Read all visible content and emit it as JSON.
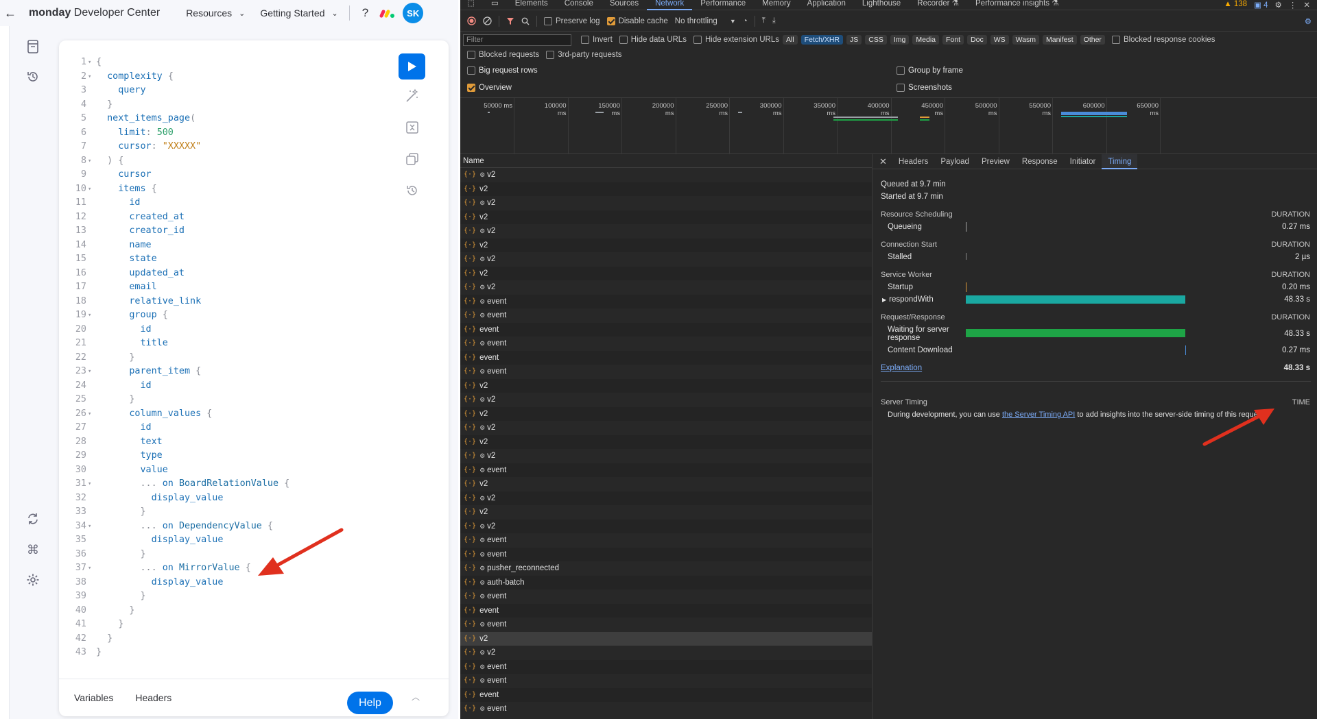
{
  "monday": {
    "brand_bold": "monday",
    "brand_rest": " Developer Center",
    "nav": [
      "Resources",
      "Getting Started"
    ],
    "help_symbol": "?",
    "avatar": "SK",
    "code_lines": [
      {
        "num": "1",
        "fold": true,
        "html": "<span class='p'>{</span>"
      },
      {
        "num": "2",
        "fold": true,
        "html": "  complexity <span class='p'>{</span>"
      },
      {
        "num": "3",
        "fold": false,
        "html": "    query"
      },
      {
        "num": "4",
        "fold": false,
        "html": "  <span class='p'>}</span>"
      },
      {
        "num": "5",
        "fold": false,
        "html": "  next_items_page<span class='p'>(</span>"
      },
      {
        "num": "6",
        "fold": false,
        "html": "    limit<span class='p'>:</span> <span class='n'>500</span>"
      },
      {
        "num": "7",
        "fold": false,
        "html": "    cursor<span class='p'>:</span> <span class='s'>\"XXXXX\"</span>"
      },
      {
        "num": "8",
        "fold": true,
        "html": "  <span class='p'>) {</span>"
      },
      {
        "num": "9",
        "fold": false,
        "html": "    cursor"
      },
      {
        "num": "10",
        "fold": true,
        "html": "    items <span class='p'>{</span>"
      },
      {
        "num": "11",
        "fold": false,
        "html": "      id"
      },
      {
        "num": "12",
        "fold": false,
        "html": "      created_at"
      },
      {
        "num": "13",
        "fold": false,
        "html": "      creator_id"
      },
      {
        "num": "14",
        "fold": false,
        "html": "      name"
      },
      {
        "num": "15",
        "fold": false,
        "html": "      state"
      },
      {
        "num": "16",
        "fold": false,
        "html": "      updated_at"
      },
      {
        "num": "17",
        "fold": false,
        "html": "      email"
      },
      {
        "num": "18",
        "fold": false,
        "html": "      relative_link"
      },
      {
        "num": "19",
        "fold": true,
        "html": "      group <span class='p'>{</span>"
      },
      {
        "num": "20",
        "fold": false,
        "html": "        id"
      },
      {
        "num": "21",
        "fold": false,
        "html": "        title"
      },
      {
        "num": "22",
        "fold": false,
        "html": "      <span class='p'>}</span>"
      },
      {
        "num": "23",
        "fold": true,
        "html": "      parent_item <span class='p'>{</span>"
      },
      {
        "num": "24",
        "fold": false,
        "html": "        id"
      },
      {
        "num": "25",
        "fold": false,
        "html": "      <span class='p'>}</span>"
      },
      {
        "num": "26",
        "fold": true,
        "html": "      column_values <span class='p'>{</span>"
      },
      {
        "num": "27",
        "fold": false,
        "html": "        id"
      },
      {
        "num": "28",
        "fold": false,
        "html": "        text"
      },
      {
        "num": "29",
        "fold": false,
        "html": "        type"
      },
      {
        "num": "30",
        "fold": false,
        "html": "        value"
      },
      {
        "num": "31",
        "fold": true,
        "html": "        <span class='p'>...</span> on <span class='t'>BoardRelationValue</span> <span class='p'>{</span>"
      },
      {
        "num": "32",
        "fold": false,
        "html": "          display_value"
      },
      {
        "num": "33",
        "fold": false,
        "html": "        <span class='p'>}</span>"
      },
      {
        "num": "34",
        "fold": true,
        "html": "        <span class='p'>...</span> on <span class='t'>DependencyValue</span> <span class='p'>{</span>"
      },
      {
        "num": "35",
        "fold": false,
        "html": "          display_value"
      },
      {
        "num": "36",
        "fold": false,
        "html": "        <span class='p'>}</span>"
      },
      {
        "num": "37",
        "fold": true,
        "html": "        <span class='p'>...</span> on <span class='t'>MirrorValue</span> <span class='p'>{</span>"
      },
      {
        "num": "38",
        "fold": false,
        "html": "          display_value"
      },
      {
        "num": "39",
        "fold": false,
        "html": "        <span class='p'>}</span>"
      },
      {
        "num": "40",
        "fold": false,
        "html": "      <span class='p'>}</span>"
      },
      {
        "num": "41",
        "fold": false,
        "html": "    <span class='p'>}</span>"
      },
      {
        "num": "42",
        "fold": false,
        "html": "  <span class='p'>}</span>"
      },
      {
        "num": "43",
        "fold": false,
        "html": "<span class='p'>}</span>"
      }
    ],
    "bottom_tabs": [
      "Variables",
      "Headers"
    ],
    "help_button": "Help"
  },
  "devtools": {
    "tabs": [
      "Elements",
      "Console",
      "Sources",
      "Network",
      "Performance",
      "Memory",
      "Application",
      "Lighthouse",
      "Recorder ⚗",
      "Performance insights ⚗"
    ],
    "active_tab": "Network",
    "warnings": "▲ 138",
    "messages": "▣ 4",
    "toolbar": {
      "preserve_log": "Preserve log",
      "disable_cache": "Disable cache",
      "throttling": "No throttling"
    },
    "filter_placeholder": "Filter",
    "filter_opts": [
      "Invert",
      "Hide data URLs",
      "Hide extension URLs"
    ],
    "type_chips": [
      "All",
      "Fetch/XHR",
      "JS",
      "CSS",
      "Img",
      "Media",
      "Font",
      "Doc",
      "WS",
      "Wasm",
      "Manifest",
      "Other"
    ],
    "active_chip": "Fetch/XHR",
    "blocked_cookies": "Blocked response cookies",
    "blocked_requests": "Blocked requests",
    "third_party": "3rd-party requests",
    "big_rows": "Big request rows",
    "group_frame": "Group by frame",
    "overview": "Overview",
    "screenshots": "Screenshots",
    "overview_ticks": [
      "50000 ms",
      "100000 ms",
      "150000 ms",
      "200000 ms",
      "250000 ms",
      "300000 ms",
      "350000 ms",
      "400000 ms",
      "450000 ms",
      "500000 ms",
      "550000 ms",
      "600000 ms",
      "650000 ms"
    ],
    "list_header": "Name",
    "requests": [
      {
        "g": true,
        "name": "v2"
      },
      {
        "g": false,
        "name": "v2"
      },
      {
        "g": true,
        "name": "v2"
      },
      {
        "g": false,
        "name": "v2"
      },
      {
        "g": true,
        "name": "v2"
      },
      {
        "g": false,
        "name": "v2"
      },
      {
        "g": true,
        "name": "v2"
      },
      {
        "g": false,
        "name": "v2"
      },
      {
        "g": true,
        "name": "v2"
      },
      {
        "g": true,
        "name": "event"
      },
      {
        "g": true,
        "name": "event"
      },
      {
        "g": false,
        "name": "event"
      },
      {
        "g": true,
        "name": "event"
      },
      {
        "g": false,
        "name": "event"
      },
      {
        "g": true,
        "name": "event"
      },
      {
        "g": false,
        "name": "v2"
      },
      {
        "g": true,
        "name": "v2"
      },
      {
        "g": false,
        "name": "v2"
      },
      {
        "g": true,
        "name": "v2"
      },
      {
        "g": false,
        "name": "v2"
      },
      {
        "g": true,
        "name": "v2"
      },
      {
        "g": true,
        "name": "event"
      },
      {
        "g": false,
        "name": "v2"
      },
      {
        "g": true,
        "name": "v2"
      },
      {
        "g": false,
        "name": "v2"
      },
      {
        "g": true,
        "name": "v2"
      },
      {
        "g": true,
        "name": "event"
      },
      {
        "g": true,
        "name": "event"
      },
      {
        "g": true,
        "name": "pusher_reconnected"
      },
      {
        "g": true,
        "name": "auth-batch"
      },
      {
        "g": true,
        "name": "event"
      },
      {
        "g": false,
        "name": "event"
      },
      {
        "g": true,
        "name": "event"
      },
      {
        "g": false,
        "name": "v2",
        "selected": true
      },
      {
        "g": true,
        "name": "v2"
      },
      {
        "g": true,
        "name": "event"
      },
      {
        "g": true,
        "name": "event"
      },
      {
        "g": false,
        "name": "event"
      },
      {
        "g": true,
        "name": "event"
      }
    ],
    "detail_tabs": [
      "Headers",
      "Payload",
      "Preview",
      "Response",
      "Initiator",
      "Timing"
    ],
    "active_detail_tab": "Timing",
    "timing": {
      "queued": "Queued at 9.7 min",
      "started": "Started at 9.7 min",
      "sections": {
        "scheduling": "Resource Scheduling",
        "connection": "Connection Start",
        "service_worker": "Service Worker",
        "request_response": "Request/Response",
        "server_timing": "Server Timing"
      },
      "duration_label": "DURATION",
      "time_label": "TIME",
      "rows": {
        "queueing": {
          "label": "Queueing",
          "value": "0.27 ms"
        },
        "stalled": {
          "label": "Stalled",
          "value": "2 µs"
        },
        "startup": {
          "label": "Startup",
          "value": "0.20 ms"
        },
        "respond_with": {
          "label": "respondWith",
          "value": "48.33 s"
        },
        "waiting": {
          "label": "Waiting for server response",
          "value": "48.33 s"
        },
        "download": {
          "label": "Content Download",
          "value": "0.27 ms"
        }
      },
      "explanation": "Explanation",
      "total": "48.33 s",
      "server_text_before": "During development, you can use ",
      "server_link": "the Server Timing API",
      "server_text_after": " to add insights into the server-side timing of this request."
    },
    "colors": {
      "respond_with_bar": "#1aa8a1",
      "waiting_bar": "#1ea446",
      "annotation_arrow": "#e0301e"
    }
  }
}
